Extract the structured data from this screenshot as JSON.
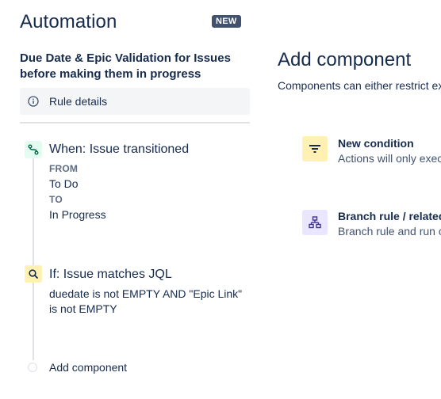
{
  "header": {
    "title": "Automation",
    "badge": "NEW"
  },
  "rule": {
    "name": "Due Date & Epic Validation for Issues before making them in progress",
    "details_label": "Rule details"
  },
  "trigger": {
    "title": "When: Issue transitioned",
    "from_label": "FROM",
    "from_value": "To Do",
    "to_label": "TO",
    "to_value": "In Progress",
    "icon": "trigger-icon",
    "color": "#e3fcef"
  },
  "condition": {
    "title": "If: Issue matches JQL",
    "jql": "duedate is not EMPTY AND \"Epic Link\" is not EMPTY",
    "icon": "search-icon",
    "color": "#fff0b3"
  },
  "add_component_label": "Add component",
  "panel": {
    "title": "Add component",
    "description": "Components can either restrict ex on related issues.",
    "components": [
      {
        "title": "New condition",
        "description": "Actions will only exec conditions preceding",
        "icon": "filter-icon",
        "color": "#fff0b3"
      },
      {
        "title": "Branch rule / related",
        "description": "Branch rule and run c actions for these issu",
        "icon": "branch-icon",
        "color": "#eae6ff"
      }
    ]
  },
  "colors": {
    "text": "#172b4d",
    "subtle": "#5e6c84",
    "badge": "#42526e",
    "line": "#dfe1e6"
  }
}
